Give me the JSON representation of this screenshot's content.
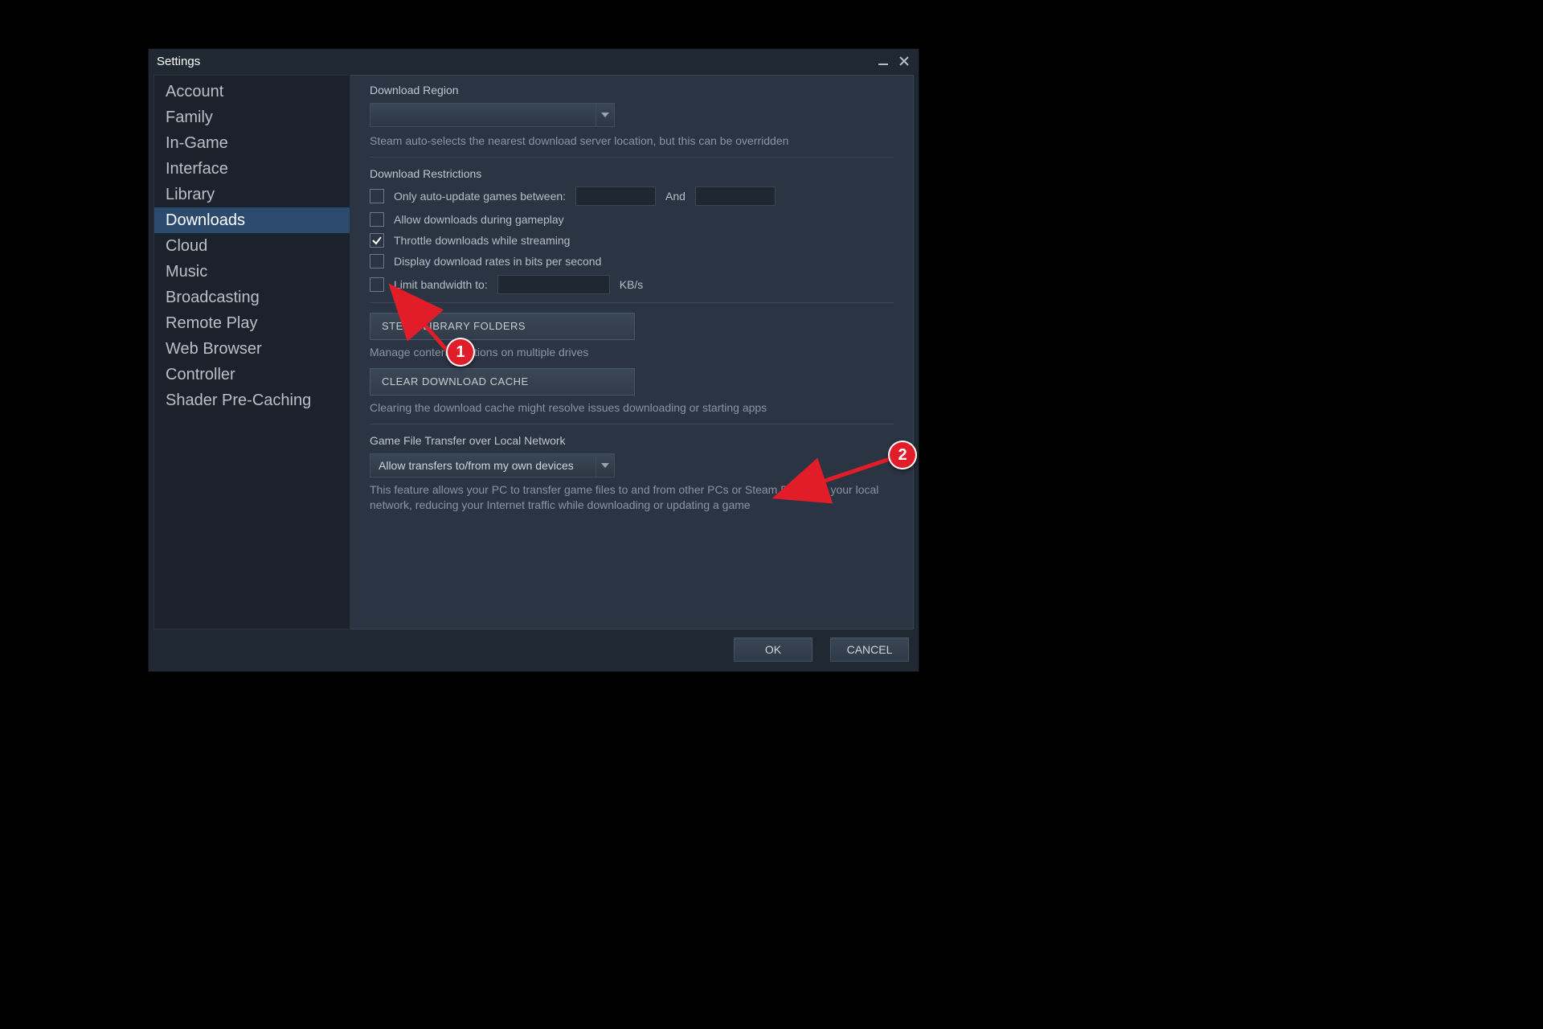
{
  "window": {
    "title": "Settings"
  },
  "sidebar": {
    "items": [
      {
        "label": "Account",
        "selected": false
      },
      {
        "label": "Family",
        "selected": false
      },
      {
        "label": "In-Game",
        "selected": false
      },
      {
        "label": "Interface",
        "selected": false
      },
      {
        "label": "Library",
        "selected": false
      },
      {
        "label": "Downloads",
        "selected": true
      },
      {
        "label": "Cloud",
        "selected": false
      },
      {
        "label": "Music",
        "selected": false
      },
      {
        "label": "Broadcasting",
        "selected": false
      },
      {
        "label": "Remote Play",
        "selected": false
      },
      {
        "label": "Web Browser",
        "selected": false
      },
      {
        "label": "Controller",
        "selected": false
      },
      {
        "label": "Shader Pre-Caching",
        "selected": false
      }
    ]
  },
  "downloads": {
    "region_heading": "Download Region",
    "region_value": "",
    "region_help": "Steam auto-selects the nearest download server location, but this can be overridden",
    "restrictions_heading": "Download Restrictions",
    "auto_update_label": "Only auto-update games between:",
    "auto_update_and": "And",
    "allow_during_gameplay_label": "Allow downloads during gameplay",
    "throttle_streaming_label": "Throttle downloads while streaming",
    "display_bits_label": "Display download rates in bits per second",
    "limit_bw_label": "Limit bandwidth to:",
    "limit_bw_unit": "KB/s",
    "library_folders_btn": "STEAM LIBRARY FOLDERS",
    "library_folders_help": "Manage content locations on multiple drives",
    "clear_cache_btn": "CLEAR DOWNLOAD CACHE",
    "clear_cache_help": "Clearing the download cache might resolve issues downloading or starting apps",
    "lan_heading": "Game File Transfer over Local Network",
    "lan_value": "Allow transfers to/from my own devices",
    "lan_help": "This feature allows your PC to transfer game files to and from other PCs or Steam Decks on your local network, reducing your Internet traffic while downloading or updating a game"
  },
  "footer": {
    "ok": "OK",
    "cancel": "CANCEL"
  },
  "annotations": {
    "m1": "1",
    "m2": "2"
  }
}
